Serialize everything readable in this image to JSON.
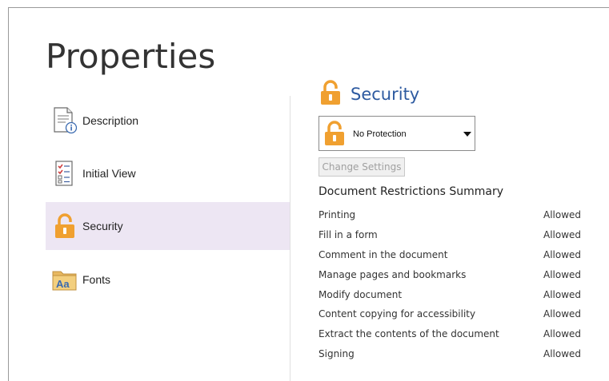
{
  "title": "Properties",
  "nav": {
    "items": [
      {
        "label": "Description",
        "icon": "description-doc-info-icon"
      },
      {
        "label": "Initial View",
        "icon": "checklist-icon"
      },
      {
        "label": "Security",
        "icon": "padlock-icon"
      },
      {
        "label": "Fonts",
        "icon": "fonts-folder-icon"
      }
    ],
    "active": "Security"
  },
  "security": {
    "heading": "Security",
    "dropdown_value": "No Protection",
    "change_button": "Change Settings",
    "summary_title": "Document Restrictions Summary",
    "restrictions": [
      {
        "name": "Printing",
        "status": "Allowed"
      },
      {
        "name": "Fill in a form",
        "status": "Allowed"
      },
      {
        "name": "Comment in the document",
        "status": "Allowed"
      },
      {
        "name": "Manage pages and bookmarks",
        "status": "Allowed"
      },
      {
        "name": "Modify document",
        "status": "Allowed"
      },
      {
        "name": "Content copying for accessibility",
        "status": "Allowed"
      },
      {
        "name": "Extract the contents of the document",
        "status": "Allowed"
      },
      {
        "name": "Signing",
        "status": "Allowed"
      }
    ]
  },
  "colors": {
    "accent_heading": "#2d5aa0",
    "lock_orange": "#f0a030",
    "active_nav_bg": "#ede6f3"
  }
}
